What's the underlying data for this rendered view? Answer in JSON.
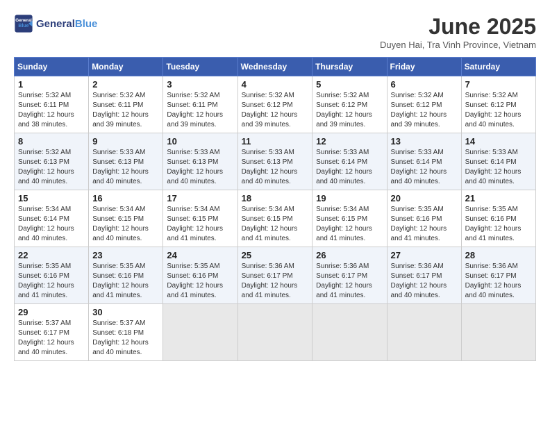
{
  "header": {
    "logo_line1": "General",
    "logo_line2": "Blue",
    "month_year": "June 2025",
    "location": "Duyen Hai, Tra Vinh Province, Vietnam"
  },
  "weekdays": [
    "Sunday",
    "Monday",
    "Tuesday",
    "Wednesday",
    "Thursday",
    "Friday",
    "Saturday"
  ],
  "weeks": [
    [
      {
        "day": "1",
        "info": "Sunrise: 5:32 AM\nSunset: 6:11 PM\nDaylight: 12 hours\nand 38 minutes."
      },
      {
        "day": "2",
        "info": "Sunrise: 5:32 AM\nSunset: 6:11 PM\nDaylight: 12 hours\nand 39 minutes."
      },
      {
        "day": "3",
        "info": "Sunrise: 5:32 AM\nSunset: 6:11 PM\nDaylight: 12 hours\nand 39 minutes."
      },
      {
        "day": "4",
        "info": "Sunrise: 5:32 AM\nSunset: 6:12 PM\nDaylight: 12 hours\nand 39 minutes."
      },
      {
        "day": "5",
        "info": "Sunrise: 5:32 AM\nSunset: 6:12 PM\nDaylight: 12 hours\nand 39 minutes."
      },
      {
        "day": "6",
        "info": "Sunrise: 5:32 AM\nSunset: 6:12 PM\nDaylight: 12 hours\nand 39 minutes."
      },
      {
        "day": "7",
        "info": "Sunrise: 5:32 AM\nSunset: 6:12 PM\nDaylight: 12 hours\nand 40 minutes."
      }
    ],
    [
      {
        "day": "8",
        "info": "Sunrise: 5:32 AM\nSunset: 6:13 PM\nDaylight: 12 hours\nand 40 minutes."
      },
      {
        "day": "9",
        "info": "Sunrise: 5:33 AM\nSunset: 6:13 PM\nDaylight: 12 hours\nand 40 minutes."
      },
      {
        "day": "10",
        "info": "Sunrise: 5:33 AM\nSunset: 6:13 PM\nDaylight: 12 hours\nand 40 minutes."
      },
      {
        "day": "11",
        "info": "Sunrise: 5:33 AM\nSunset: 6:13 PM\nDaylight: 12 hours\nand 40 minutes."
      },
      {
        "day": "12",
        "info": "Sunrise: 5:33 AM\nSunset: 6:14 PM\nDaylight: 12 hours\nand 40 minutes."
      },
      {
        "day": "13",
        "info": "Sunrise: 5:33 AM\nSunset: 6:14 PM\nDaylight: 12 hours\nand 40 minutes."
      },
      {
        "day": "14",
        "info": "Sunrise: 5:33 AM\nSunset: 6:14 PM\nDaylight: 12 hours\nand 40 minutes."
      }
    ],
    [
      {
        "day": "15",
        "info": "Sunrise: 5:34 AM\nSunset: 6:14 PM\nDaylight: 12 hours\nand 40 minutes."
      },
      {
        "day": "16",
        "info": "Sunrise: 5:34 AM\nSunset: 6:15 PM\nDaylight: 12 hours\nand 40 minutes."
      },
      {
        "day": "17",
        "info": "Sunrise: 5:34 AM\nSunset: 6:15 PM\nDaylight: 12 hours\nand 41 minutes."
      },
      {
        "day": "18",
        "info": "Sunrise: 5:34 AM\nSunset: 6:15 PM\nDaylight: 12 hours\nand 41 minutes."
      },
      {
        "day": "19",
        "info": "Sunrise: 5:34 AM\nSunset: 6:15 PM\nDaylight: 12 hours\nand 41 minutes."
      },
      {
        "day": "20",
        "info": "Sunrise: 5:35 AM\nSunset: 6:16 PM\nDaylight: 12 hours\nand 41 minutes."
      },
      {
        "day": "21",
        "info": "Sunrise: 5:35 AM\nSunset: 6:16 PM\nDaylight: 12 hours\nand 41 minutes."
      }
    ],
    [
      {
        "day": "22",
        "info": "Sunrise: 5:35 AM\nSunset: 6:16 PM\nDaylight: 12 hours\nand 41 minutes."
      },
      {
        "day": "23",
        "info": "Sunrise: 5:35 AM\nSunset: 6:16 PM\nDaylight: 12 hours\nand 41 minutes."
      },
      {
        "day": "24",
        "info": "Sunrise: 5:35 AM\nSunset: 6:16 PM\nDaylight: 12 hours\nand 41 minutes."
      },
      {
        "day": "25",
        "info": "Sunrise: 5:36 AM\nSunset: 6:17 PM\nDaylight: 12 hours\nand 41 minutes."
      },
      {
        "day": "26",
        "info": "Sunrise: 5:36 AM\nSunset: 6:17 PM\nDaylight: 12 hours\nand 41 minutes."
      },
      {
        "day": "27",
        "info": "Sunrise: 5:36 AM\nSunset: 6:17 PM\nDaylight: 12 hours\nand 40 minutes."
      },
      {
        "day": "28",
        "info": "Sunrise: 5:36 AM\nSunset: 6:17 PM\nDaylight: 12 hours\nand 40 minutes."
      }
    ],
    [
      {
        "day": "29",
        "info": "Sunrise: 5:37 AM\nSunset: 6:17 PM\nDaylight: 12 hours\nand 40 minutes."
      },
      {
        "day": "30",
        "info": "Sunrise: 5:37 AM\nSunset: 6:18 PM\nDaylight: 12 hours\nand 40 minutes."
      },
      {
        "day": "",
        "info": ""
      },
      {
        "day": "",
        "info": ""
      },
      {
        "day": "",
        "info": ""
      },
      {
        "day": "",
        "info": ""
      },
      {
        "day": "",
        "info": ""
      }
    ]
  ]
}
